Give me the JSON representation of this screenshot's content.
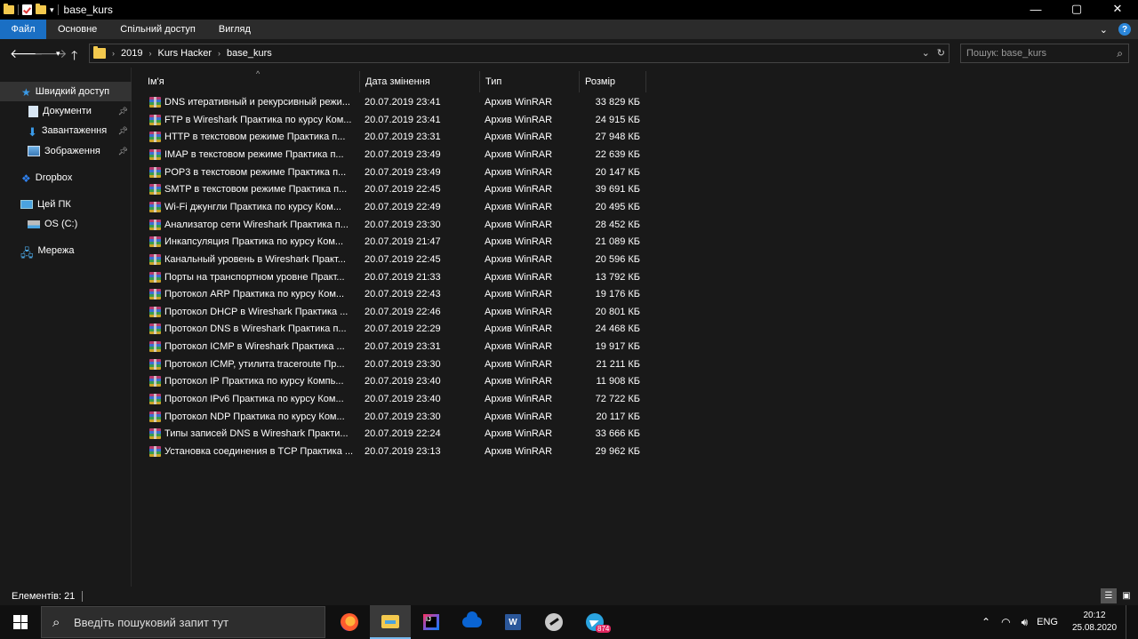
{
  "window": {
    "title": "base_kurs",
    "controls": {
      "minimize": "—",
      "maximize": "▢",
      "close": "✕"
    }
  },
  "ribbon": {
    "tabs": [
      "Файл",
      "Основне",
      "Спільний доступ",
      "Вигляд"
    ],
    "help": "?"
  },
  "address": {
    "crumbs": [
      "2019",
      "Kurs Hacker",
      "base_kurs"
    ],
    "search_placeholder": "Пошук: base_kurs"
  },
  "sidebar": {
    "items": [
      {
        "label": "Швидкий доступ",
        "icon": "star-icon",
        "pinned": false
      },
      {
        "label": "Документи",
        "icon": "document-icon",
        "pinned": true
      },
      {
        "label": "Завантаження",
        "icon": "download-icon",
        "pinned": true
      },
      {
        "label": "Зображення",
        "icon": "image-icon",
        "pinned": true
      },
      {
        "label": "Dropbox",
        "icon": "dropbox-icon",
        "pinned": false
      },
      {
        "label": "Цей ПК",
        "icon": "computer-icon",
        "pinned": false
      },
      {
        "label": "OS (C:)",
        "icon": "drive-icon",
        "pinned": false
      },
      {
        "label": "Мережа",
        "icon": "network-icon",
        "pinned": false
      }
    ]
  },
  "columns": {
    "name": "Ім'я",
    "date": "Дата змінення",
    "type": "Тип",
    "size": "Розмір"
  },
  "files": [
    {
      "name": "DNS итеративный и рекурсивный режи...",
      "date": "20.07.2019 23:41",
      "type": "Архив WinRAR",
      "size": "33 829 КБ"
    },
    {
      "name": "FTP в Wireshark  Практика по курсу Ком...",
      "date": "20.07.2019 23:41",
      "type": "Архив WinRAR",
      "size": "24 915 КБ"
    },
    {
      "name": "HTTP в текстовом режиме  Практика п...",
      "date": "20.07.2019 23:31",
      "type": "Архив WinRAR",
      "size": "27 948 КБ"
    },
    {
      "name": "IMAP в текстовом режиме  Практика п...",
      "date": "20.07.2019 23:49",
      "type": "Архив WinRAR",
      "size": "22 639 КБ"
    },
    {
      "name": "POP3 в текстовом режиме  Практика п...",
      "date": "20.07.2019 23:49",
      "type": "Архив WinRAR",
      "size": "20 147 КБ"
    },
    {
      "name": "SMTP в текстовом режиме  Практика п...",
      "date": "20.07.2019 22:45",
      "type": "Архив WinRAR",
      "size": "39 691 КБ"
    },
    {
      "name": "Wi-Fi джунгли  Практика по курсу Ком...",
      "date": "20.07.2019 22:49",
      "type": "Архив WinRAR",
      "size": "20 495 КБ"
    },
    {
      "name": "Анализатор сети Wireshark  Практика п...",
      "date": "20.07.2019 23:30",
      "type": "Архив WinRAR",
      "size": "28 452 КБ"
    },
    {
      "name": "Инкапсуляция  Практика по курсу Ком...",
      "date": "20.07.2019 21:47",
      "type": "Архив WinRAR",
      "size": "21 089 КБ"
    },
    {
      "name": "Канальный уровень в Wireshark  Практ...",
      "date": "20.07.2019 22:45",
      "type": "Архив WinRAR",
      "size": "20 596 КБ"
    },
    {
      "name": "Порты на транспортном уровне  Практ...",
      "date": "20.07.2019 21:33",
      "type": "Архив WinRAR",
      "size": "13 792 КБ"
    },
    {
      "name": "Протокол ARP  Практика по курсу Ком...",
      "date": "20.07.2019 22:43",
      "type": "Архив WinRAR",
      "size": "19 176 КБ"
    },
    {
      "name": "Протокол DHCP в Wireshark  Практика ...",
      "date": "20.07.2019 22:46",
      "type": "Архив WinRAR",
      "size": "20 801 КБ"
    },
    {
      "name": "Протокол DNS в Wireshark  Практика п...",
      "date": "20.07.2019 22:29",
      "type": "Архив WinRAR",
      "size": "24 468 КБ"
    },
    {
      "name": "Протокол ICMP в Wireshark  Практика ...",
      "date": "20.07.2019 23:31",
      "type": "Архив WinRAR",
      "size": "19 917 КБ"
    },
    {
      "name": "Протокол ICMP, утилита traceroute  Пр...",
      "date": "20.07.2019 23:30",
      "type": "Архив WinRAR",
      "size": "21 211 КБ"
    },
    {
      "name": "Протокол IP  Практика по курсу Компь...",
      "date": "20.07.2019 23:40",
      "type": "Архив WinRAR",
      "size": "11 908 КБ"
    },
    {
      "name": "Протокол IPv6  Практика по курсу Ком...",
      "date": "20.07.2019 23:40",
      "type": "Архив WinRAR",
      "size": "72 722 КБ"
    },
    {
      "name": "Протокол NDP  Практика по курсу Ком...",
      "date": "20.07.2019 23:30",
      "type": "Архив WinRAR",
      "size": "20 117 КБ"
    },
    {
      "name": "Типы записей DNS в Wireshark  Практи...",
      "date": "20.07.2019 22:24",
      "type": "Архив WinRAR",
      "size": "33 666 КБ"
    },
    {
      "name": "Установка соединения в TCP  Практика ...",
      "date": "20.07.2019 23:13",
      "type": "Архив WinRAR",
      "size": "29 962 КБ"
    }
  ],
  "status": {
    "count": "Елементів: 21"
  },
  "taskbar": {
    "search_placeholder": "Введіть пошуковий запит тут",
    "apps": [
      "firefox-icon",
      "file-explorer-icon",
      "intellij-icon",
      "onedrive-icon",
      "word-icon",
      "arc-icon",
      "telegram-icon"
    ],
    "telegram_badge": "874",
    "language": "ENG",
    "time": "20:12",
    "date": "25.08.2020"
  },
  "colors": {
    "accent": "#1a6fc4",
    "background": "#191919",
    "folder": "#f3c94e"
  }
}
